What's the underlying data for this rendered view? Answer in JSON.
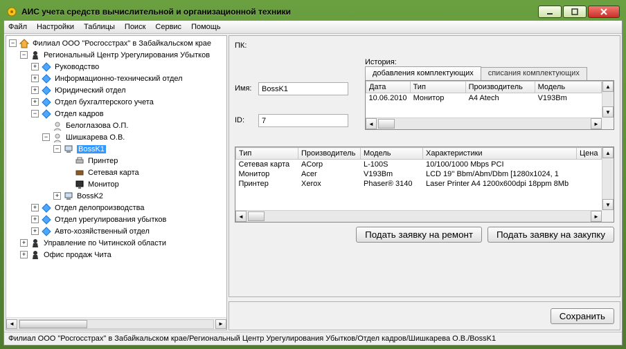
{
  "window": {
    "title": "АИС учета средств вычислительной и организационной техники",
    "min": "−",
    "max": "□",
    "close": "✕"
  },
  "menu": {
    "file": "Файл",
    "settings": "Настройки",
    "tables": "Таблицы",
    "search": "Поиск",
    "service": "Сервис",
    "help": "Помощь"
  },
  "tree": {
    "n0": "Филиал ООО \"Росгосстрах\" в Забайкальском крае",
    "n1": "Региональный Центр Урегулирования Убытков",
    "n2": "Руководство",
    "n3": "Информационно-технический отдел",
    "n4": "Юридический отдел",
    "n5": "Отдел бухгалтерского учета",
    "n6": "Отдел кадров",
    "n7": "Белоглазова О.П.",
    "n8": "Шишкарева О.В.",
    "n9": "BossK1",
    "n10": "Принтер",
    "n11": "Сетевая карта",
    "n12": "Монитор",
    "n13": "BossK2",
    "n14": "Отдел делопроизводства",
    "n15": "Отдел урегулирования убытков",
    "n16": "Авто-хозяйственный отдел",
    "n17": "Управление по Читинской области",
    "n18": "Офис продаж Чита"
  },
  "form": {
    "pk_label": "ПК:",
    "name_label": "Имя:",
    "name_value": "BossK1",
    "id_label": "ID:",
    "id_value": "7",
    "history_label": "История:",
    "tab_add": "добавления комплектующих",
    "tab_del": "списания комплектующих",
    "hist_cols": {
      "c0": "Дата",
      "c1": "Тип",
      "c2": "Производитель",
      "c3": "Модель"
    },
    "hist_row": {
      "c0": "10.06.2010",
      "c1": "Монитор",
      "c2": "A4 Atech",
      "c3": "V193Bm"
    },
    "comp_cols": {
      "c0": "Тип",
      "c1": "Производитель",
      "c2": "Модель",
      "c3": "Характеристики",
      "c4": "Цена"
    },
    "comp_rows": {
      "r0": {
        "c0": "Сетевая карта",
        "c1": "ACorp",
        "c2": "L-100S",
        "c3": "10/100/1000 Mbps PCI"
      },
      "r1": {
        "c0": "Монитор",
        "c1": "Acer",
        "c2": "V193Bm",
        "c3": " LCD 19''   Bbm/Abm/Dbm [1280x1024, 1"
      },
      "r2": {
        "c0": "Принтер",
        "c1": "Xerox",
        "c2": "Phaser® 3140",
        "c3": " Laser Printer A4 1200x600dpi 18ppm 8Mb"
      }
    },
    "btn_repair": "Подать заявку на ремонт",
    "btn_purchase": "Подать заявку на закупку",
    "btn_save": "Сохранить"
  },
  "status": "Филиал ООО \"Росгосстрах\" в Забайкальском крае/Региональный Центр Урегулирования Убытков/Отдел кадров/Шишкарева О.В./BossK1"
}
